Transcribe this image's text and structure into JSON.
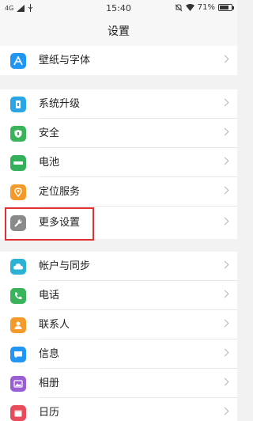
{
  "status_bar": {
    "network": "4G",
    "time": "15:40",
    "battery": "71%",
    "icons": [
      "signal-icon",
      "usb-icon",
      "mute-icon",
      "wifi-icon",
      "battery-icon"
    ],
    "battery_level": 0.71
  },
  "header": {
    "title": "设置"
  },
  "group1": [
    {
      "label": "壁纸与字体",
      "icon": "font-icon",
      "color": "#2196f3"
    }
  ],
  "group2": [
    {
      "label": "系统升级",
      "icon": "update-icon",
      "color": "#2aa6e8"
    },
    {
      "label": "安全",
      "icon": "shield-icon",
      "color": "#3bb35b"
    },
    {
      "label": "电池",
      "icon": "battery-icon",
      "color": "#35b05a"
    },
    {
      "label": "定位服务",
      "icon": "location-icon",
      "color": "#f39a2a"
    },
    {
      "label": "更多设置",
      "icon": "wrench-icon",
      "color": "#8a8a8a"
    }
  ],
  "group3": [
    {
      "label": "帐户与同步",
      "icon": "cloud-icon",
      "color": "#2bb2d4"
    },
    {
      "label": "电话",
      "icon": "phone-icon",
      "color": "#3bb35b"
    },
    {
      "label": "联系人",
      "icon": "contacts-icon",
      "color": "#f39a2a"
    },
    {
      "label": "信息",
      "icon": "message-icon",
      "color": "#2196f3"
    },
    {
      "label": "相册",
      "icon": "album-icon",
      "color": "#9b5fd4"
    },
    {
      "label": "日历",
      "icon": "calendar-icon",
      "color": "#e84b5a"
    }
  ]
}
